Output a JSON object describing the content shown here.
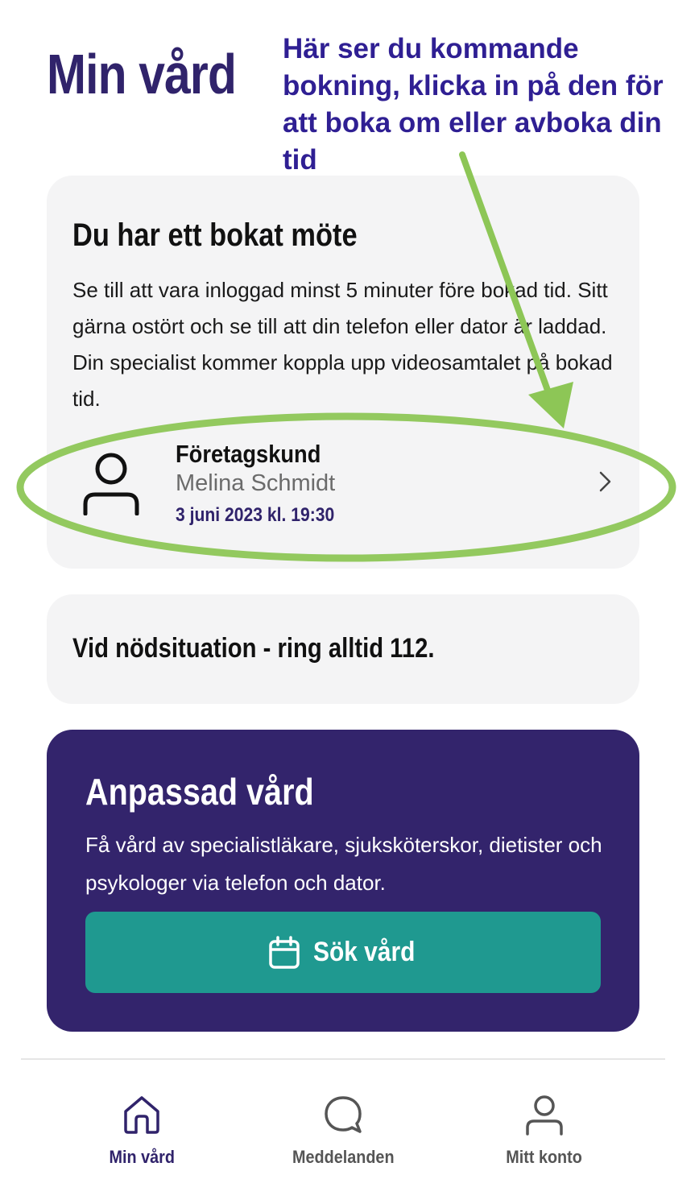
{
  "page": {
    "title": "Min vård"
  },
  "annotation": {
    "text": "Här ser du kommande bokning, klicka in på den för att boka om eller avboka din tid",
    "text_color": "#2f1f93",
    "highlight_color": "#8dc656"
  },
  "booking_card": {
    "heading": "Du har ett bokat möte",
    "description": "Se till att vara inloggad minst 5 minuter före bokad tid. Sitt gärna ostört och se till att din telefon eller dator är laddad. Din specialist kommer koppla upp videosamtalet på bokad tid.",
    "appointment": {
      "type": "Företagskund",
      "specialist": "Melina Schmidt",
      "datetime": "3 juni 2023 kl. 19:30",
      "icon": "person-icon"
    }
  },
  "emergency_card": {
    "text": "Vid nödsituation - ring alltid 112."
  },
  "promo_card": {
    "title": "Anpassad vård",
    "description": "Få vård av specialistläkare, sjuksköterskor, dietister och psykologer via telefon och dator.",
    "button_label": "Sök vård",
    "button_icon": "calendar-icon"
  },
  "bottom_nav": {
    "items": [
      {
        "label": "Min vård",
        "icon": "home-icon",
        "active": true
      },
      {
        "label": "Meddelanden",
        "icon": "chat-bubble-icon",
        "active": false
      },
      {
        "label": "Mitt konto",
        "icon": "user-icon",
        "active": false
      }
    ]
  },
  "colors": {
    "brand_purple": "#30236b",
    "accent_teal": "#1f9990",
    "card_background": "#f4f4f5"
  }
}
